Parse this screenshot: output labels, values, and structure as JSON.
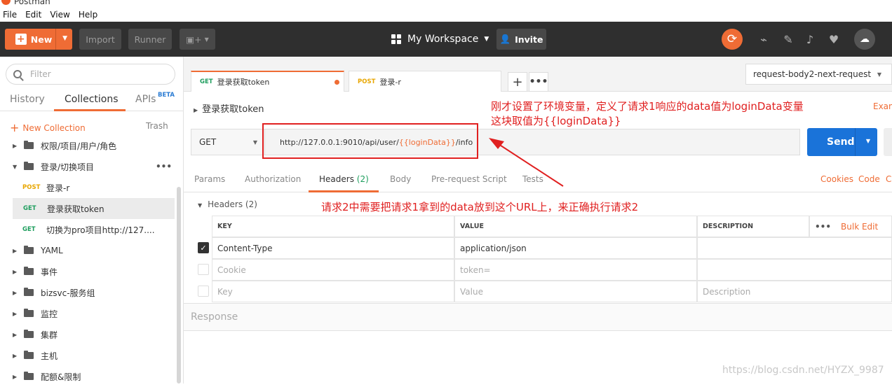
{
  "app": {
    "title": "Postman"
  },
  "menu": [
    "File",
    "Edit",
    "View",
    "Help"
  ],
  "header": {
    "new_label": "New",
    "import_label": "Import",
    "runner_label": "Runner",
    "workspace": "My Workspace",
    "invite": "Invite"
  },
  "sidebar": {
    "filter_placeholder": "Filter",
    "tabs": [
      "History",
      "Collections",
      "APIs"
    ],
    "beta": "BETA",
    "new_collection": "New Collection",
    "trash": "Trash",
    "items": [
      {
        "type": "folder",
        "label": "权限/项目/用户/角色",
        "expanded": false
      },
      {
        "type": "folder",
        "label": "登录/切换项目",
        "expanded": true
      },
      {
        "type": "request",
        "method": "POST",
        "label": "登录-r"
      },
      {
        "type": "request",
        "method": "GET",
        "label": "登录获取token",
        "selected": true
      },
      {
        "type": "request",
        "method": "GET",
        "label": "切换为pro项目http://127...."
      },
      {
        "type": "folder",
        "label": "YAML",
        "expanded": false
      },
      {
        "type": "folder",
        "label": "事件",
        "expanded": false
      },
      {
        "type": "folder",
        "label": "bizsvc-服务组",
        "expanded": false
      },
      {
        "type": "folder",
        "label": "监控",
        "expanded": false
      },
      {
        "type": "folder",
        "label": "集群",
        "expanded": false
      },
      {
        "type": "folder",
        "label": "主机",
        "expanded": false
      },
      {
        "type": "folder",
        "label": "配额&限制",
        "expanded": false
      }
    ]
  },
  "tabs": [
    {
      "method": "GET",
      "label": "登录获取token"
    },
    {
      "method": "POST",
      "label": "登录-r"
    }
  ],
  "environment": "request-body2-next-request",
  "request": {
    "name": "登录获取token",
    "examples_label": "Exan",
    "method": "GET",
    "url_prefix": "http://127.0.0.1:9010/api/user/",
    "url_var": "{{loginData}}",
    "url_suffix": "/info",
    "send_label": "Send"
  },
  "option_tabs": [
    "Params",
    "Authorization",
    "Headers",
    "Body",
    "Pre-request Script",
    "Tests"
  ],
  "headers_count": "(2)",
  "option_links": [
    "Cookies",
    "Code",
    "Co"
  ],
  "headers_section": "Headers (2)",
  "table": {
    "columns": [
      "KEY",
      "VALUE",
      "DESCRIPTION"
    ],
    "bulk_edit": "Bulk Edit",
    "rows": [
      {
        "key": "Content-Type",
        "value": "application/json",
        "description": "",
        "checked": true
      },
      {
        "key": "Cookie",
        "value": "token=",
        "description": "",
        "checked": false
      },
      {
        "key": "Key",
        "value": "Value",
        "description": "Description",
        "checked": false
      }
    ]
  },
  "response_label": "Response",
  "annotations": {
    "line1": "刚才设置了环境变量，定义了请求1响应的data值为loginData变量",
    "line2": "这块取值为{{loginData}}",
    "line3": "请求2中需要把请求1拿到的data放到这个URL上，来正确执行请求2"
  },
  "watermark": "https://blog.csdn.net/HYZX_9987",
  "colors": {
    "accent": "#ef6c35",
    "send": "#1a73d9",
    "annotation": "#e02020",
    "get": "#1e9e5e",
    "post": "#e8a600"
  }
}
